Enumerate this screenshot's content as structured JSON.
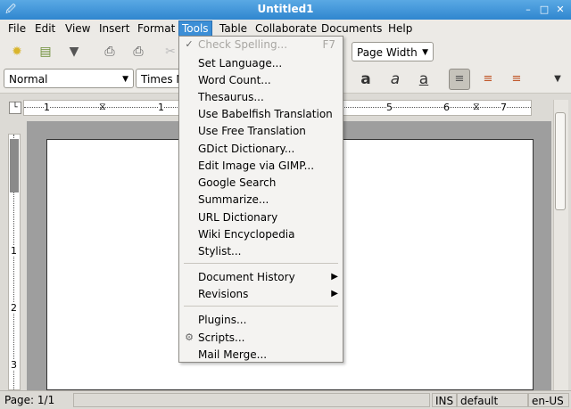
{
  "window": {
    "title": "Untitled1"
  },
  "menubar": [
    "File",
    "Edit",
    "View",
    "Insert",
    "Format",
    "Tools",
    "Table",
    "Collaborate",
    "Documents",
    "Help"
  ],
  "toolbar": {
    "zoom_value": "Page Width",
    "style_value": "Normal",
    "font_value": "Times N"
  },
  "ruler": {
    "h_numbers": [
      "1",
      "1",
      "5",
      "6",
      "7"
    ],
    "v_numbers": [
      "1",
      "2",
      "3"
    ]
  },
  "tools_menu": {
    "items": [
      {
        "label": "Check Spelling...",
        "shortcut": "F7",
        "disabled": true
      },
      {
        "label": "Set Language..."
      },
      {
        "label": "Word Count..."
      },
      {
        "label": "Thesaurus..."
      },
      {
        "label": "Use Babelfish Translation"
      },
      {
        "label": "Use Free Translation"
      },
      {
        "label": "GDict Dictionary..."
      },
      {
        "label": "Edit Image via GIMP..."
      },
      {
        "label": "Google Search"
      },
      {
        "label": "Summarize..."
      },
      {
        "label": "URL Dictionary"
      },
      {
        "label": "Wiki Encyclopedia"
      },
      {
        "label": "Stylist..."
      },
      {
        "label": "Document History",
        "submenu": true
      },
      {
        "label": "Revisions",
        "submenu": true
      },
      {
        "label": "Plugins..."
      },
      {
        "label": "Scripts..."
      },
      {
        "label": "Mail Merge..."
      }
    ]
  },
  "statusbar": {
    "page": "Page: 1/1",
    "mode": "INS",
    "style": "default",
    "lang": "en-US"
  }
}
